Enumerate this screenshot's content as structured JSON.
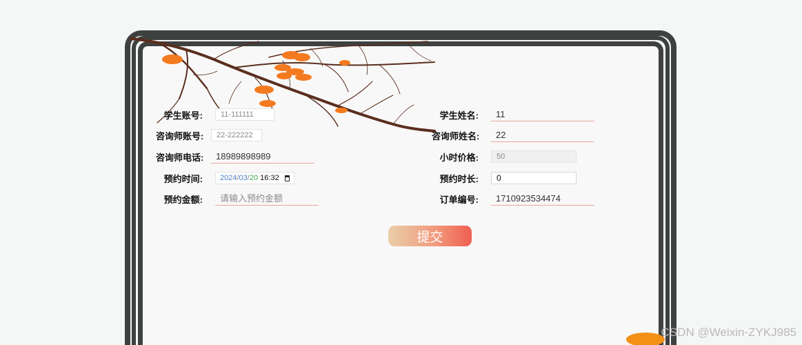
{
  "form": {
    "student_account": {
      "label": "学生账号:",
      "value": "11-111111"
    },
    "consultant_account": {
      "label": "咨询师账号:",
      "value": "22-222222"
    },
    "consultant_phone": {
      "label": "咨询师电话:",
      "value": "18989898989"
    },
    "appointment_time": {
      "label": "预约时间:",
      "year": "2024",
      "month": "03",
      "day": "20",
      "time": "16:32"
    },
    "appointment_amount": {
      "label": "预约金额:",
      "placeholder": "请输入预约金额"
    },
    "student_name": {
      "label": "学生姓名:",
      "value": "11"
    },
    "consultant_name": {
      "label": "咨询师姓名:",
      "value": "22"
    },
    "hourly_price": {
      "label": "小时价格:",
      "value": "50"
    },
    "appointment_duration": {
      "label": "预约时长:",
      "value": "0"
    },
    "order_number": {
      "label": "订单编号:",
      "value": "1710923534474"
    }
  },
  "submit_label": "提交",
  "watermark": "CSDN @Weixin-ZYKJ985",
  "colors": {
    "frame": "#3f4140",
    "underline": "#e8a79b",
    "button_start": "#e9cfa8",
    "button_end": "#ef5f52",
    "persimmon": "#f47a1f",
    "branch": "#5a2e1e"
  }
}
